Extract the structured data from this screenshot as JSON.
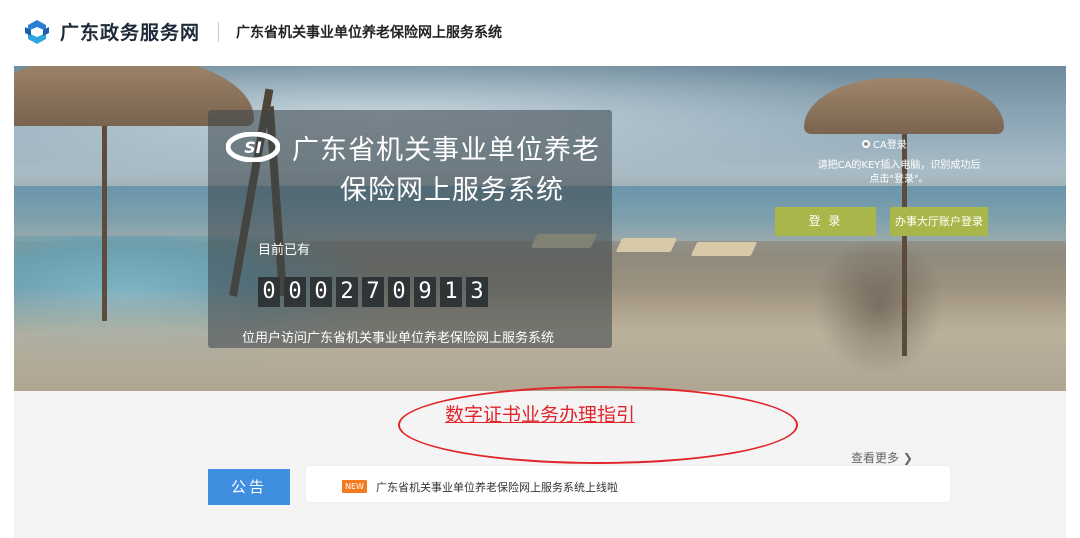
{
  "header": {
    "logo_text": "广东政务服务网",
    "system_title": "广东省机关事业单位养老保险网上服务系统"
  },
  "banner": {
    "title_line1": "广东省机关事业单位养老",
    "title_line2": "保险网上服务系统",
    "counter_prefix": "目前已有",
    "digits": [
      "0",
      "0",
      "0",
      "2",
      "7",
      "0",
      "9",
      "1",
      "3"
    ],
    "counter_suffix": "位用户访问广东省机关事业单位养老保险网上服务系统"
  },
  "login": {
    "ca_option_label": "CA登录",
    "ca_hint_line1": "请把CA的KEY插入电脑，识别成功后",
    "ca_hint_line2": "点击\"登录\"。",
    "login_button": "登 录",
    "hall_login_button": "办事大厅账户登录"
  },
  "guide": {
    "link_text": "数字证书业务办理指引"
  },
  "notice": {
    "more_link": "查看更多",
    "tab_label": "公告",
    "badge": "NEW",
    "item_text": "广东省机关事业单位养老保险网上服务系统上线啦"
  },
  "colors": {
    "accent_blue": "#3f8ee0",
    "login_green": "#a9b74a",
    "guide_red": "#e2252b",
    "badge_orange": "#f47a1f"
  }
}
